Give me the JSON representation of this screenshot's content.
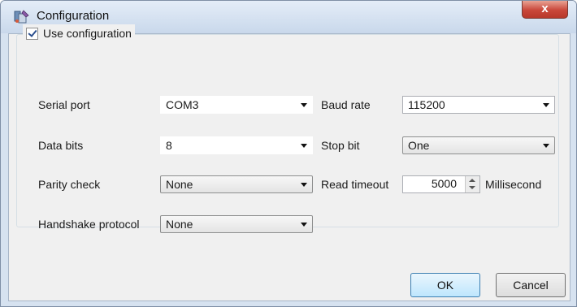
{
  "window": {
    "title": "Configuration",
    "close_glyph": "x",
    "icon": "app-icon"
  },
  "group": {
    "label": "Use configuration",
    "checked": true
  },
  "fields": {
    "serial_port_label": "Serial port",
    "serial_port_value": "COM3",
    "baud_rate_label": "Baud rate",
    "baud_rate_value": "115200",
    "data_bits_label": "Data bits",
    "data_bits_value": "8",
    "stop_bit_label": "Stop bit",
    "stop_bit_value": "One",
    "parity_label": "Parity check",
    "parity_value": "None",
    "read_timeout_label": "Read timeout",
    "read_timeout_value": "5000",
    "read_timeout_unit": "Millisecond",
    "handshake_label": "Handshake protocol",
    "handshake_value": "None"
  },
  "buttons": {
    "ok": "OK",
    "cancel": "Cancel"
  },
  "colors": {
    "default_button": "#bee6fd",
    "close_button": "#c9473a",
    "checkmark": "#2b4f8e"
  }
}
